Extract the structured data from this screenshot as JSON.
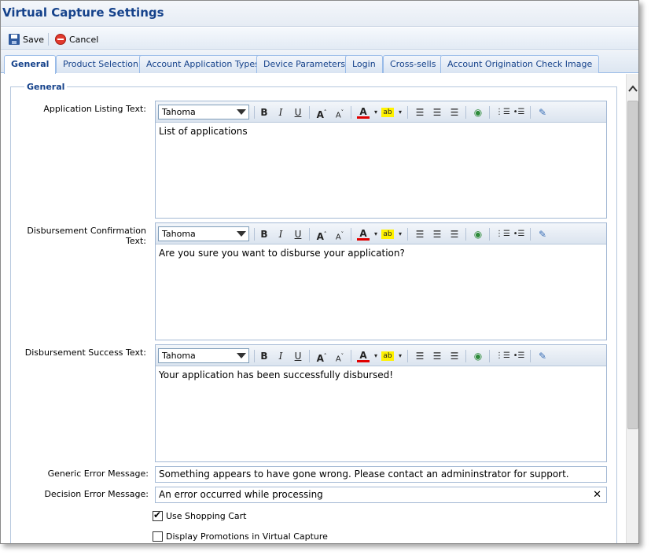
{
  "window": {
    "title": "Virtual Capture Settings"
  },
  "toolbar": {
    "save_label": "Save",
    "cancel_label": "Cancel"
  },
  "tabs": [
    {
      "label": "General",
      "active": true
    },
    {
      "label": "Product Selection"
    },
    {
      "label": "Account Application Types"
    },
    {
      "label": "Device Parameters"
    },
    {
      "label": "Login"
    },
    {
      "label": "Cross-sells"
    },
    {
      "label": "Account Origination Check Image"
    }
  ],
  "section": {
    "legend": "General"
  },
  "editor_font": "Tahoma",
  "editors": [
    {
      "label": "Application Listing Text:",
      "value": "List of applications"
    },
    {
      "label": "Disbursement Confirmation Text:",
      "value": "Are you sure you want to disburse your application?"
    },
    {
      "label": "Disbursement Success Text:",
      "value": "Your application has been successfully disbursed!"
    }
  ],
  "fields": {
    "generic_error": {
      "label": "Generic Error Message:",
      "value": "Something appears to have gone wrong. Please contact an admininstrator for support."
    },
    "decision_error": {
      "label": "Decision Error Message:",
      "value": "An error occurred while processing"
    }
  },
  "checkboxes": [
    {
      "label": "Use Shopping Cart",
      "checked": true
    },
    {
      "label": "Display Promotions in Virtual Capture",
      "checked": false
    }
  ]
}
